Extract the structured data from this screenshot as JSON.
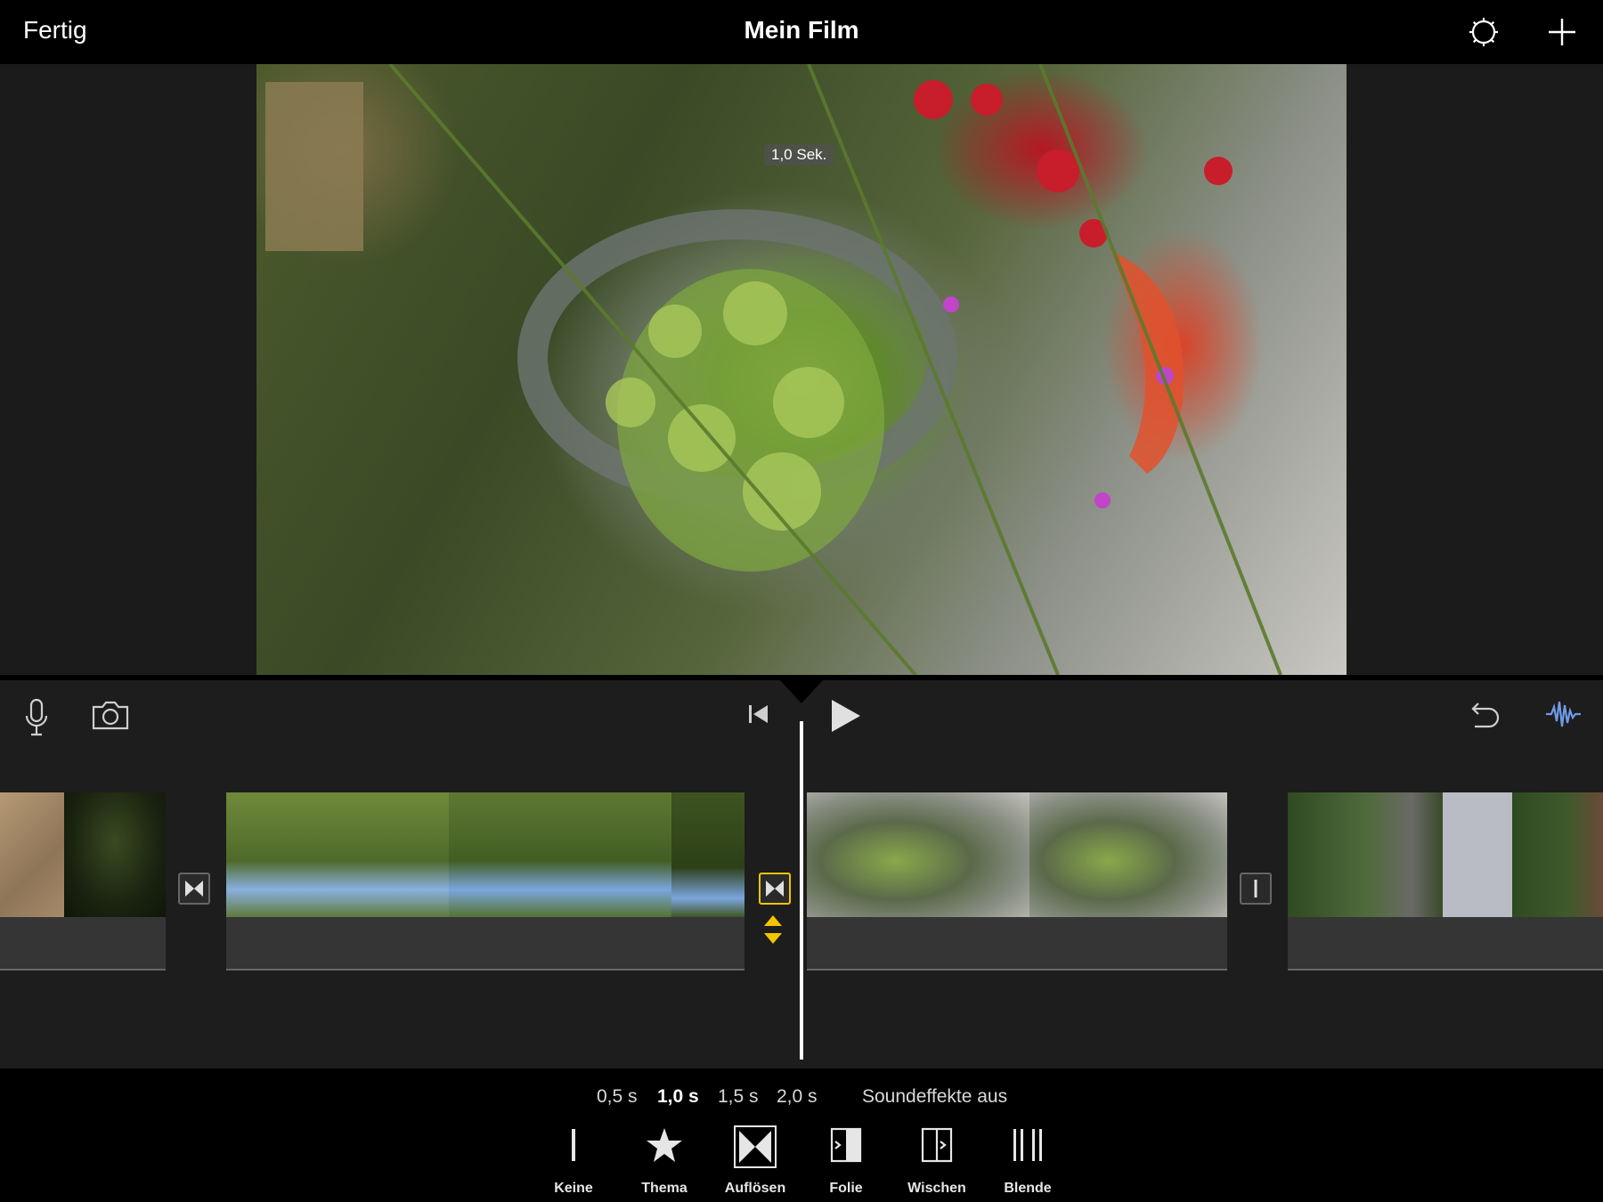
{
  "topbar": {
    "done_label": "Fertig",
    "title": "Mein Film",
    "settings_icon": "gear-icon",
    "add_icon": "plus-icon"
  },
  "viewer": {
    "duration_badge": "1,0 Sek."
  },
  "editor": {
    "tools_left": [
      "microphone-icon",
      "camera-icon"
    ],
    "playback": [
      "skip-to-start-icon",
      "play-icon"
    ],
    "tools_right": [
      "undo-icon",
      "audio-waveform-icon"
    ],
    "accent_color": "#f3c400",
    "selected_transition_index": 1
  },
  "timeline": {
    "clips": [
      {
        "name": "clip-1"
      },
      {
        "name": "clip-2"
      },
      {
        "name": "clip-3"
      },
      {
        "name": "clip-4"
      }
    ],
    "transitions": [
      {
        "type": "cross-dissolve"
      },
      {
        "type": "cross-dissolve",
        "selected": true
      },
      {
        "type": "none"
      }
    ]
  },
  "bottombar": {
    "durations": [
      {
        "label": "0,5 s",
        "selected": false
      },
      {
        "label": "1,0 s",
        "selected": true
      },
      {
        "label": "1,5 s",
        "selected": false
      },
      {
        "label": "2,0 s",
        "selected": false
      }
    ],
    "sound_effects_label": "Soundeffekte aus",
    "transition_types": [
      {
        "label": "Keine",
        "icon": "none-transition-icon"
      },
      {
        "label": "Thema",
        "icon": "star-icon"
      },
      {
        "label": "Auflösen",
        "icon": "dissolve-icon",
        "selected": true
      },
      {
        "label": "Folie",
        "icon": "slide-icon"
      },
      {
        "label": "Wischen",
        "icon": "wipe-icon"
      },
      {
        "label": "Blende",
        "icon": "fade-icon"
      }
    ]
  }
}
